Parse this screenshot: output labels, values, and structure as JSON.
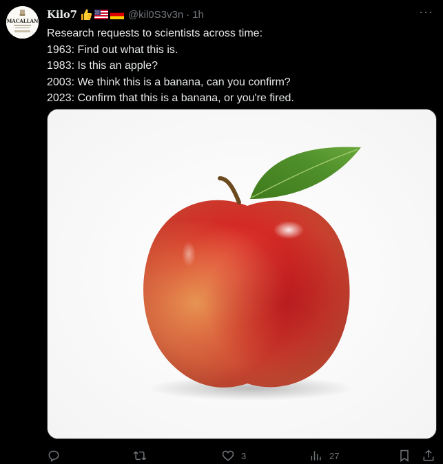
{
  "author": {
    "display_name": "Kilo7",
    "handle": "@kil0S3v3n",
    "separator": "·",
    "time": "1h",
    "badges": [
      "thumbs-up-icon",
      "us-flag-icon",
      "german-flag-icon"
    ],
    "avatar_logo_text": "MACALLAN"
  },
  "tweet": {
    "lines": [
      "Research requests to scientists across time:",
      "1963: Find out what this is.",
      "1983: Is this an apple?",
      "2003: We think this is a banana, can you confirm?",
      "2023: Confirm that this is a banana, or you're fired."
    ]
  },
  "media": {
    "subject": "apple-photo"
  },
  "actions": {
    "reply": {
      "icon": "reply-icon",
      "count": ""
    },
    "retweet": {
      "icon": "retweet-icon",
      "count": ""
    },
    "like": {
      "icon": "heart-icon",
      "count": "3"
    },
    "views": {
      "icon": "views-icon",
      "count": "27"
    },
    "bookmark": {
      "icon": "bookmark-icon",
      "count": ""
    },
    "share": {
      "icon": "share-icon",
      "count": ""
    }
  },
  "more_menu": "···",
  "colors": {
    "background": "#000000",
    "text": "#e7e9ea",
    "muted": "#71767b",
    "border": "#2f3336"
  }
}
